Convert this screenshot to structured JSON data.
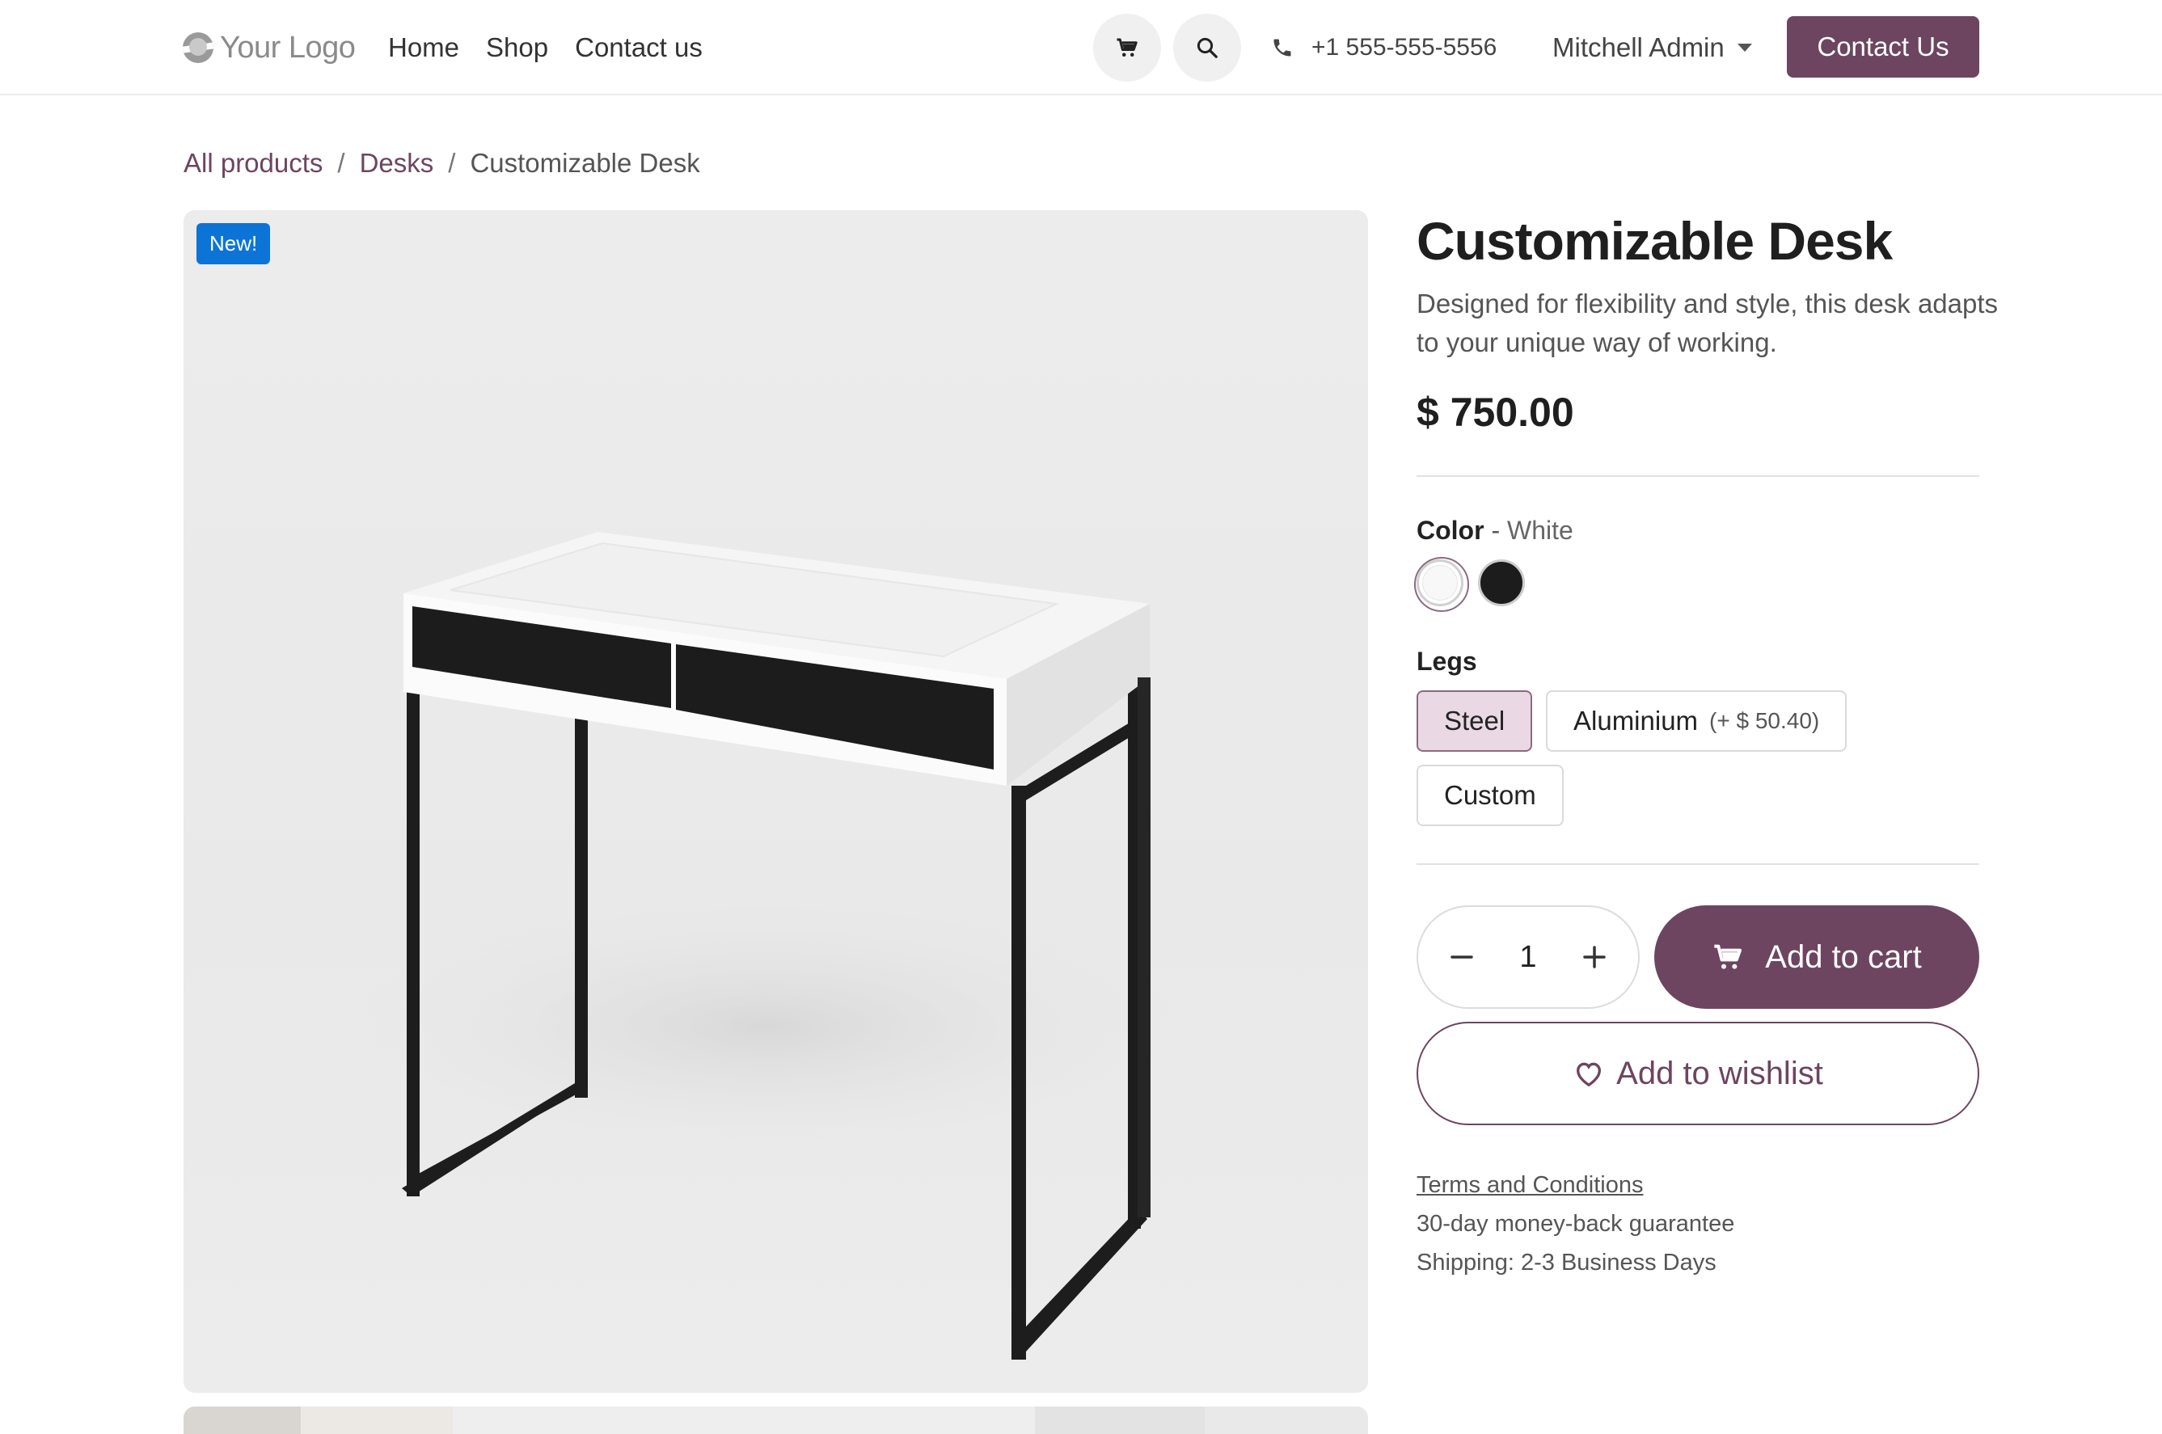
{
  "header": {
    "logo_text": "Your Logo",
    "nav": [
      "Home",
      "Shop",
      "Contact us"
    ],
    "phone": "+1 555-555-5556",
    "user": "Mitchell Admin",
    "cta": "Contact Us"
  },
  "breadcrumb": {
    "items": [
      "All products",
      "Desks"
    ],
    "separator": "/",
    "current": "Customizable Desk"
  },
  "product": {
    "badge": "New!",
    "title": "Customizable Desk",
    "description": "Designed for flexibility and style, this desk adapts to your unique way of working.",
    "price": "$ 750.00",
    "color_label": "Color",
    "color_sep": " - ",
    "color_value": "White",
    "colors": [
      "#ffffff",
      "#1c1c1c"
    ],
    "legs_label": "Legs",
    "legs_options": [
      {
        "label": "Steel",
        "extra": "",
        "selected": true
      },
      {
        "label": "Aluminium",
        "extra": "(+ $ 50.40)",
        "selected": false
      },
      {
        "label": "Custom",
        "extra": "",
        "selected": false
      }
    ],
    "quantity": "1",
    "add_to_cart": "Add to cart",
    "add_to_wishlist": "Add to wishlist",
    "terms": "Terms and Conditions",
    "guarantee": "30-day money-back guarantee",
    "shipping": "Shipping: 2-3 Business Days"
  },
  "colors": {
    "brand": "#6d4560",
    "badge": "#0b74d6",
    "selected_option_bg": "#ead9e4"
  },
  "icons": [
    "logo-icon",
    "cart-icon",
    "search-icon",
    "phone-icon",
    "caret-down-icon",
    "minus-icon",
    "plus-icon",
    "heart-icon"
  ]
}
